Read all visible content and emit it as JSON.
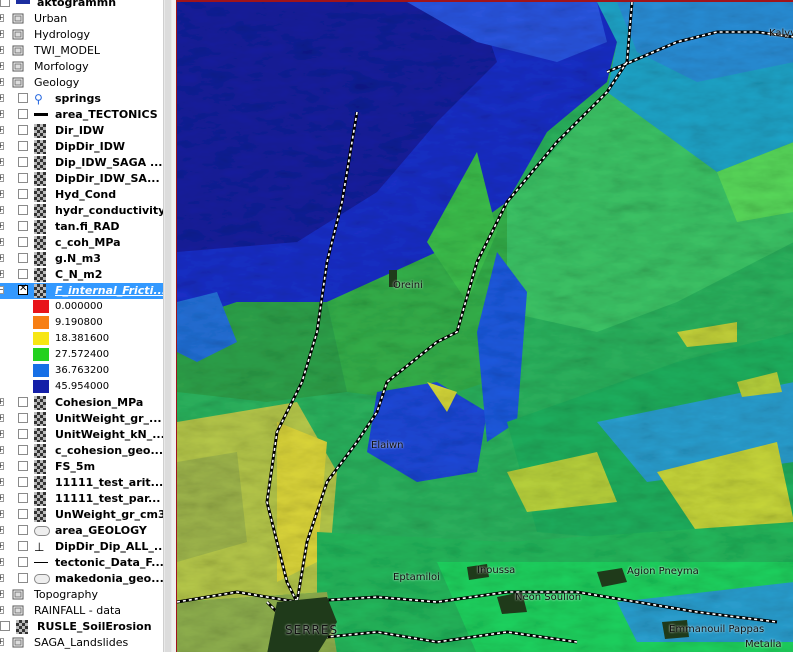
{
  "layers": [
    {
      "label": "aktogrammh",
      "bold": true,
      "indent": 0,
      "kind": "vector-top"
    },
    {
      "label": "Urban",
      "bold": false,
      "indent": 0,
      "kind": "group"
    },
    {
      "label": "Hydrology",
      "bold": false,
      "indent": 0,
      "kind": "group"
    },
    {
      "label": "TWI_MODEL",
      "bold": false,
      "indent": 0,
      "kind": "group"
    },
    {
      "label": "Morfology",
      "bold": false,
      "indent": 0,
      "kind": "group"
    },
    {
      "label": "Geology",
      "bold": false,
      "indent": 0,
      "kind": "group"
    },
    {
      "label": "springs",
      "bold": true,
      "indent": 1,
      "kind": "point"
    },
    {
      "label": "area_TECTONICS",
      "bold": true,
      "indent": 1,
      "kind": "line"
    },
    {
      "label": "Dir_IDW",
      "bold": true,
      "indent": 1,
      "kind": "raster"
    },
    {
      "label": "DipDir_IDW",
      "bold": true,
      "indent": 1,
      "kind": "raster"
    },
    {
      "label": "Dip_IDW_SAGA ...",
      "bold": true,
      "indent": 1,
      "kind": "raster"
    },
    {
      "label": "DipDir_IDW_SA...",
      "bold": true,
      "indent": 1,
      "kind": "raster"
    },
    {
      "label": "Hyd_Cond",
      "bold": true,
      "indent": 1,
      "kind": "raster"
    },
    {
      "label": "hydr_conductivity",
      "bold": true,
      "indent": 1,
      "kind": "raster"
    },
    {
      "label": "tan.fi_RAD",
      "bold": true,
      "indent": 1,
      "kind": "raster"
    },
    {
      "label": "c_coh_MPa",
      "bold": true,
      "indent": 1,
      "kind": "raster"
    },
    {
      "label": "g.N_m3",
      "bold": true,
      "indent": 1,
      "kind": "raster"
    },
    {
      "label": "C_N_m2",
      "bold": true,
      "indent": 1,
      "kind": "raster"
    },
    {
      "label": "F_internal_Fricti...",
      "bold": true,
      "indent": 1,
      "kind": "raster",
      "selected": true,
      "checked": true
    }
  ],
  "legend": [
    {
      "value": "0.000000",
      "color": "#e8141a"
    },
    {
      "value": "9.190800",
      "color": "#f77f14"
    },
    {
      "value": "18.381600",
      "color": "#f7e614"
    },
    {
      "value": "27.572400",
      "color": "#22d11e"
    },
    {
      "value": "36.763200",
      "color": "#1770e6"
    },
    {
      "value": "45.954000",
      "color": "#141fa8"
    }
  ],
  "layers_after": [
    {
      "label": "Cohesion_MPa",
      "bold": true,
      "indent": 1,
      "kind": "raster"
    },
    {
      "label": "UnitWeight_gr_...",
      "bold": true,
      "indent": 1,
      "kind": "raster"
    },
    {
      "label": "UnitWeight_kN_...",
      "bold": true,
      "indent": 1,
      "kind": "raster"
    },
    {
      "label": "c_cohesion_geo...",
      "bold": true,
      "indent": 1,
      "kind": "raster"
    },
    {
      "label": "FS_5m",
      "bold": true,
      "indent": 1,
      "kind": "raster"
    },
    {
      "label": "11111_test_arit...",
      "bold": true,
      "indent": 1,
      "kind": "raster"
    },
    {
      "label": "11111_test_par...",
      "bold": true,
      "indent": 1,
      "kind": "raster"
    },
    {
      "label": "UnWeight_gr_cm3",
      "bold": true,
      "indent": 1,
      "kind": "raster"
    },
    {
      "label": "area_GEOLOGY",
      "bold": true,
      "indent": 1,
      "kind": "polygon"
    },
    {
      "label": "DipDir_Dip_ALL_...",
      "bold": true,
      "indent": 1,
      "kind": "dip"
    },
    {
      "label": "tectonic_Data_F...",
      "bold": true,
      "indent": 1,
      "kind": "thinline"
    },
    {
      "label": "makedonia_geo...",
      "bold": true,
      "indent": 1,
      "kind": "polygon"
    },
    {
      "label": "Topography",
      "bold": false,
      "indent": 0,
      "kind": "group"
    },
    {
      "label": "RAINFALL - data",
      "bold": false,
      "indent": 0,
      "kind": "group"
    },
    {
      "label": "RUSLE_SoilErosion",
      "bold": true,
      "indent": 0,
      "kind": "raster"
    },
    {
      "label": "SAGA_Landslides",
      "bold": false,
      "indent": 0,
      "kind": "group"
    }
  ],
  "map_labels": [
    {
      "text": "Oreini"
    },
    {
      "text": "Elaiwn"
    },
    {
      "text": "Inoussa"
    },
    {
      "text": "Eptamiloi"
    },
    {
      "text": "Agion Pneyma"
    },
    {
      "text": "Neon Soulion"
    },
    {
      "text": "SERRES"
    },
    {
      "text": "Emmanouil Pappas"
    },
    {
      "text": "Metalla"
    },
    {
      "text": "Kalyv"
    }
  ]
}
